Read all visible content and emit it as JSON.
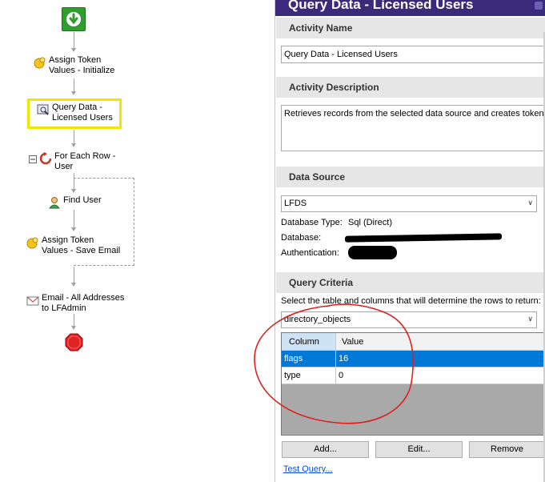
{
  "workflow": {
    "nodes": [
      {
        "label": "Assign Token\nValues - Initialize",
        "icon": "token-icon"
      },
      {
        "label": "Query Data -\nLicensed Users",
        "icon": "query-icon"
      },
      {
        "label": "For Each Row -\nUser",
        "icon": "loop-icon"
      },
      {
        "label": "Find User",
        "icon": "user-icon"
      },
      {
        "label": "Assign Token\nValues - Save Email",
        "icon": "token-icon"
      },
      {
        "label": "Email - All Addresses\nto LFAdmin",
        "icon": "email-icon"
      }
    ],
    "start_icon": "start-icon",
    "stop_icon": "stop-icon",
    "collapse_icon": "collapse-icon",
    "selection_color": "#f2e600"
  },
  "pane": {
    "title": "Query Data - Licensed Users",
    "title_color": "#3a2a7a",
    "sections": {
      "activity_name": "Activity Name",
      "activity_description": "Activity Description",
      "data_source": "Data Source",
      "query_criteria": "Query Criteria"
    },
    "activity_name_value": "Query Data - Licensed Users",
    "activity_description_value": "Retrieves records from the selected data source and creates tokens.",
    "data_source_value": "LFDS",
    "db_type_label": "Database Type:",
    "db_type_value": "Sql (Direct)",
    "database_label": "Database:",
    "authentication_label": "Authentication:",
    "criteria_prompt": "Select the table and columns that will determine the rows to return:",
    "table_value": "directory_objects",
    "grid": {
      "headers": [
        "Column",
        "Value"
      ],
      "rows": [
        {
          "column": "flags",
          "value": "16",
          "selected": true
        },
        {
          "column": "type",
          "value": "0",
          "selected": false
        }
      ],
      "selected_color": "#0078d7"
    },
    "buttons": {
      "add": "Add...",
      "edit": "Edit...",
      "remove": "Remove"
    },
    "test_query": "Test Query...",
    "annotation_color": "#e02020"
  }
}
